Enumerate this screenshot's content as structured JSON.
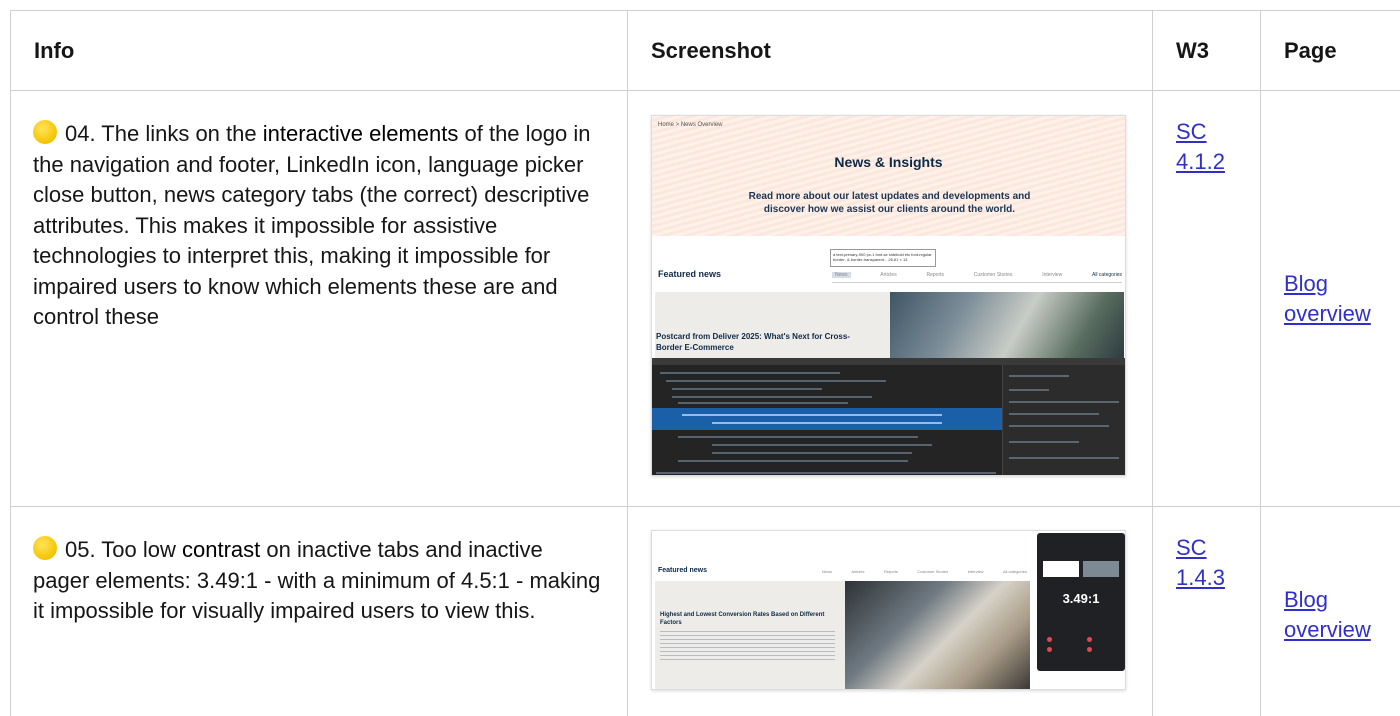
{
  "headers": {
    "info": "Info",
    "screenshot": "Screenshot",
    "w3": "W3",
    "page": "Page"
  },
  "rows": [
    {
      "number": "04. The links on the ",
      "emphasis": "interactive elements",
      "rest": " of the logo in the navigation and footer, LinkedIn icon, language picker close button, news category tabs (the correct) descriptive attributes. This makes it impossible for assistive technologies to interpret this, making it impossible for impaired users to know which elements these are and control these",
      "w3": [
        "SC",
        "4.1.2"
      ],
      "page": [
        "Blog",
        "overview"
      ],
      "shot": {
        "breadcrumb": "Home > News Overview",
        "hero_title": "News & Insights",
        "hero_subtitle": "Read more about our latest updates and developments and discover how we assist our clients around the world.",
        "tooltip": "a text-primary-900 px-1 font-se sidebold etc font-regular border- & border-transparent...",
        "tooltip_size": "26.61 × 13",
        "featured": "Featured news",
        "tabs": [
          "News",
          "Articles",
          "Reports",
          "Customer Stories",
          "Interview",
          "All categories"
        ],
        "card_title": "Postcard from Deliver 2025: What's Next for Cross-Border E-Commerce"
      }
    },
    {
      "number": "05. Too low ",
      "emphasis": "contrast",
      "rest": " on inactive tabs and inactive pager elements: 3.49:1 - with a minimum of 4.5:1 - making it impossible for visually impaired users to view this.",
      "w3": [
        "SC",
        "1.4.3"
      ],
      "page": [
        "Blog",
        "overview"
      ],
      "shot": {
        "featured": "Featured news",
        "tabs": [
          "News",
          "Articles",
          "Reports",
          "Customer Stories",
          "Interview",
          "All categories"
        ],
        "card_title": "Highest and Lowest Conversion Rates Based on Different Factors",
        "ratio": "3.49:1"
      }
    }
  ]
}
